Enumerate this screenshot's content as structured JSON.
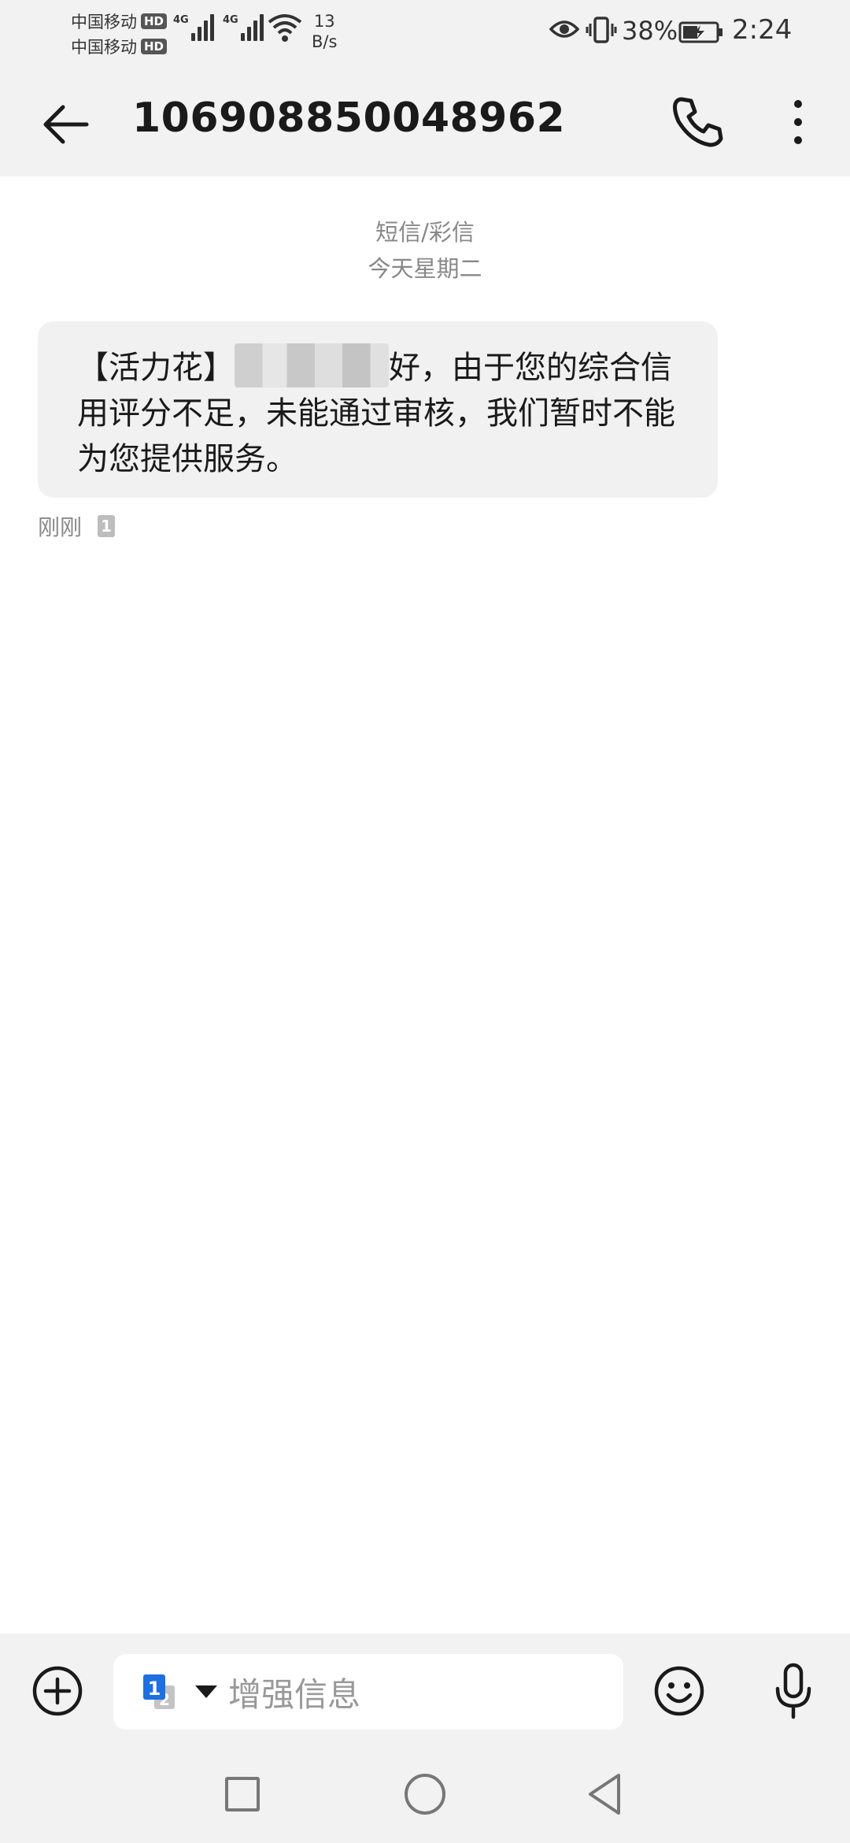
{
  "status_bar": {
    "carrier_1": "中国移动",
    "carrier_2": "中国移动",
    "hd_badge": "HD",
    "network_1": "4G",
    "network_2": "4G",
    "speed_value": "13",
    "speed_unit": "B/s",
    "battery_percent": "38%",
    "time": "2:24"
  },
  "header": {
    "contact_number": "106908850048962",
    "back_icon": "arrow-left-icon",
    "call_icon": "phone-icon",
    "more_icon": "more-vertical-icon"
  },
  "thread": {
    "message_type": "短信/彩信",
    "date_label": "今天星期二"
  },
  "message": {
    "text_before": "【活力花】",
    "text_after": "好，由于您的综合信用评分不足，未能通过审核，我们暂时不能为您提供服务。",
    "time": "刚刚",
    "sim_badge": "1"
  },
  "composer": {
    "placeholder": "增强信息",
    "sim_icon": "dual-sim-switch-icon",
    "add_icon": "plus-circle-icon",
    "emoji_icon": "smiley-icon",
    "mic_icon": "microphone-icon"
  },
  "colors": {
    "bar_background": "#f2f2f2",
    "bubble_background": "#f1f1f1",
    "sim_blue": "#1e6fe0",
    "secondary_text": "#888888"
  }
}
